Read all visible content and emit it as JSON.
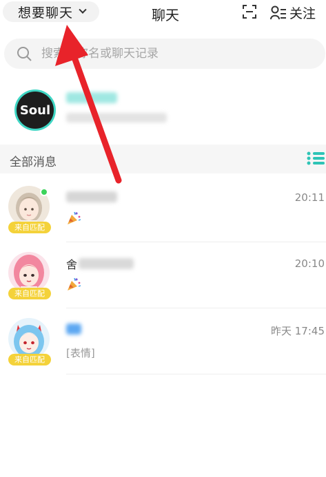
{
  "header": {
    "mood_label": "想要聊天",
    "title": "聊天",
    "follow_label": "关注"
  },
  "search": {
    "placeholder": "搜索昵称名或聊天记录"
  },
  "official": {
    "avatar_text": "Soul"
  },
  "section": {
    "title": "全部消息"
  },
  "conversations": [
    {
      "name_partial": "",
      "time": "20:11",
      "badge": "来自匹配",
      "preview": ""
    },
    {
      "name_partial": "舍",
      "time": "20:10",
      "badge": "来自匹配",
      "preview": ""
    },
    {
      "name_partial": "",
      "time": "昨天 17:45",
      "badge": "来自匹配",
      "preview": "[表情]"
    }
  ],
  "colors": {
    "accent_teal": "#3fd6c4",
    "badge_yellow": "#f4d23a",
    "online_green": "#3cd35b",
    "annotation_red": "#e8232a"
  }
}
